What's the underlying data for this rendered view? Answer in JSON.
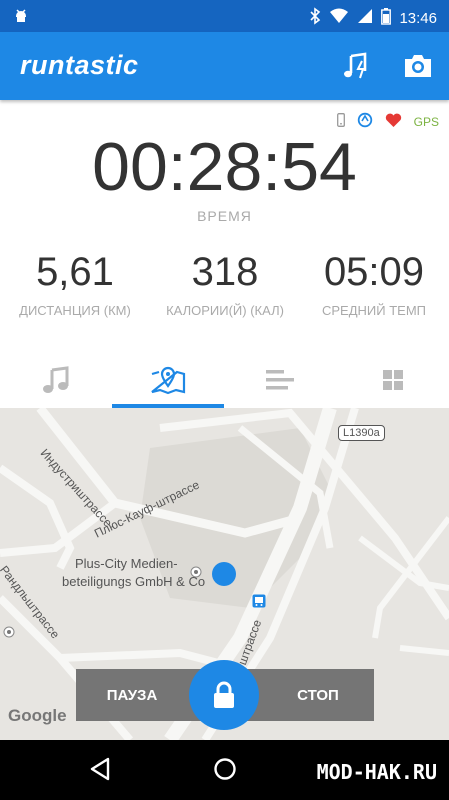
{
  "statusbar": {
    "time": "13:46"
  },
  "appbar": {
    "logo": "runtastic"
  },
  "sensors": {
    "gps_label": "GPS"
  },
  "timer": {
    "value": "00:28:54",
    "label": "ВРЕМЯ"
  },
  "stats": [
    {
      "value": "5,61",
      "label": "ДИСТАНЦИЯ (КМ)"
    },
    {
      "value": "318",
      "label": "КАЛОРИИ(Й) (КАЛ)"
    },
    {
      "value": "05:09",
      "label": "СРЕДНИЙ ТЕМП"
    }
  ],
  "tabs": {
    "active": "map"
  },
  "map": {
    "streets": [
      "Индустриштрассе",
      "Плюс-Кауф-штрассе",
      "Рандльштрассе",
      "штрассе"
    ],
    "road_badge": "L1390a",
    "poi_line1": "Plus-City Medien-",
    "poi_line2": "beteiligungs GmbH & Co",
    "attribution": "Google"
  },
  "controls": {
    "pause_label": "ПАУЗА",
    "stop_label": "СТОП"
  },
  "watermark": "MOD-HAK.RU",
  "colors": {
    "accent": "#1e88e5",
    "statusbar": "#1565c0",
    "gps": "#7cb342",
    "heart": "#e53935"
  }
}
